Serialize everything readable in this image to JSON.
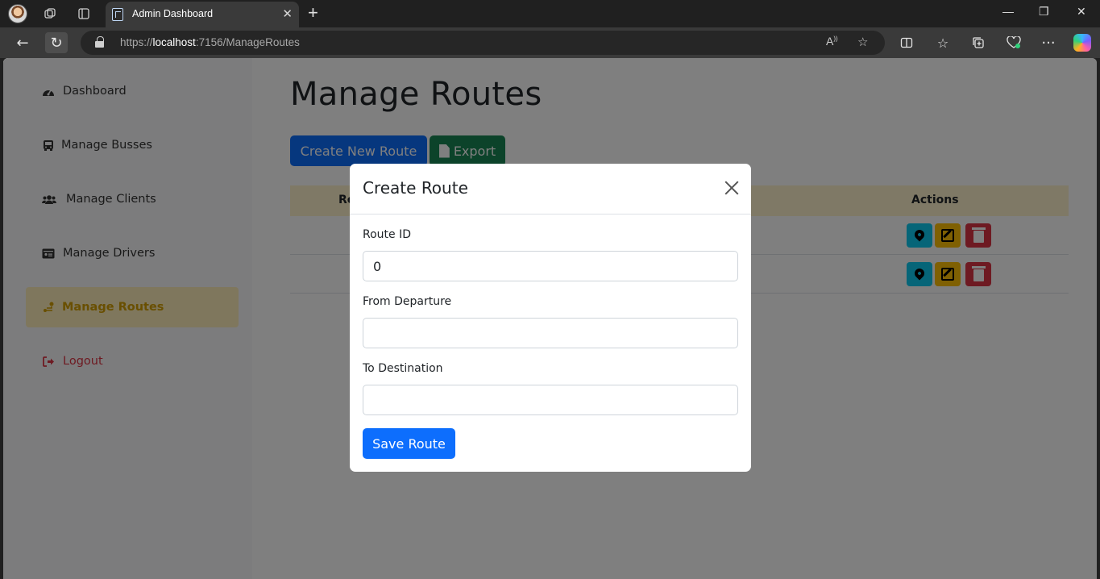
{
  "browser": {
    "tab_title": "Admin Dashboard",
    "tab_close": "✕",
    "new_tab": "+",
    "url_prefix": "https://",
    "url_host": "localhost",
    "url_rest": ":7156/ManageRoutes",
    "window_controls": [
      "—",
      "❐",
      "✕"
    ]
  },
  "sidebar": {
    "items": [
      {
        "label": "Dashboard",
        "icon": "gauge-icon"
      },
      {
        "label": "Manage Busses",
        "icon": "bus-icon"
      },
      {
        "label": "Manage Clients",
        "icon": "users-icon"
      },
      {
        "label": "Manage Drivers",
        "icon": "id-card-icon"
      },
      {
        "label": "Manage Routes",
        "icon": "route-icon",
        "active": true
      },
      {
        "label": "Logout",
        "icon": "logout-icon"
      }
    ]
  },
  "main": {
    "title": "Manage Routes",
    "create_button": "Create New Route",
    "export_button": "Export",
    "table": {
      "header_first": "Ro",
      "header_actions": "Actions"
    }
  },
  "modal": {
    "title": "Create Route",
    "fields": [
      {
        "label": "Route ID",
        "value": "0",
        "placeholder": ""
      },
      {
        "label": "From Departure",
        "value": "",
        "placeholder": ""
      },
      {
        "label": "To Destination",
        "value": "",
        "placeholder": ""
      }
    ],
    "save_button": "Save Route"
  },
  "colors": {
    "primary": "#0d6efd",
    "success": "#198754",
    "warning": "#ffc107",
    "info": "#0dcaf0",
    "danger": "#dc3545",
    "active_bg": "#ffeeba",
    "table_header_bg": "#fff3cd"
  }
}
